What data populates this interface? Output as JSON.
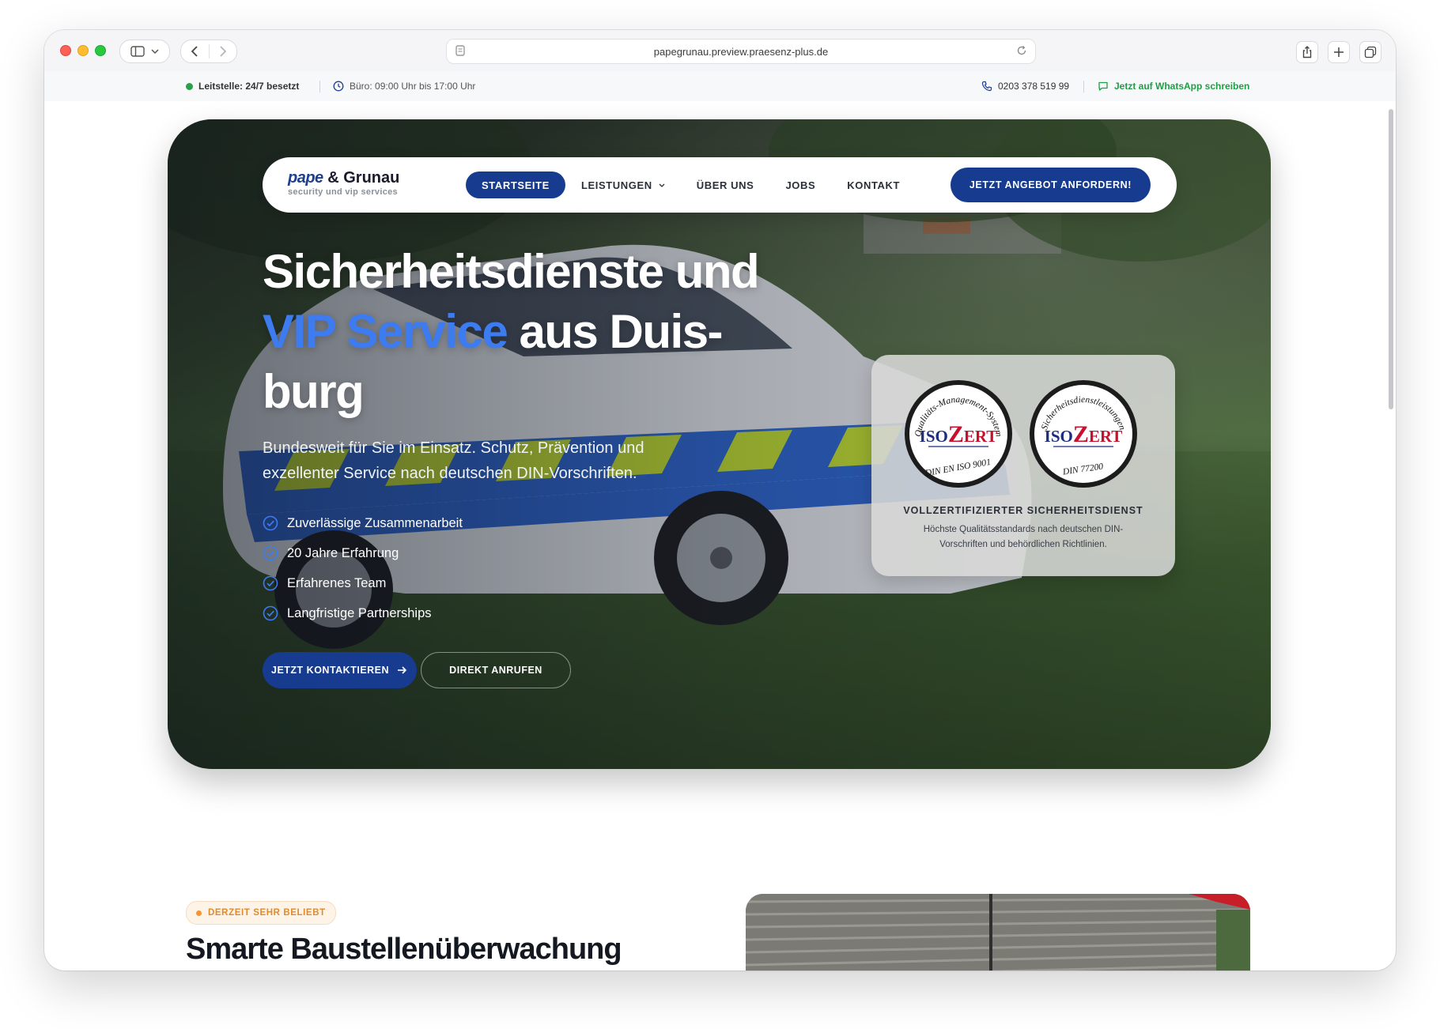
{
  "browser": {
    "url": "papegrunau.preview.praesenz-plus.de"
  },
  "topbar": {
    "status": "Leitstelle: 24/7 besetzt",
    "hours": "Büro: 09:00 Uhr bis 17:00 Uhr",
    "phone": "0203 378 519 99",
    "whatsapp": "Jetzt auf WhatsApp schreiben"
  },
  "logo": {
    "brand_part1": "pape",
    "brand_part2": "& Grunau",
    "tagline": "security und vip services"
  },
  "nav": {
    "items": [
      {
        "label": "STARTSEITE"
      },
      {
        "label": "LEISTUNGEN"
      },
      {
        "label": "ÜBER UNS"
      },
      {
        "label": "JOBS"
      },
      {
        "label": "KONTAKT"
      }
    ],
    "cta": "JETZT ANGEBOT ANFORDERN!"
  },
  "hero": {
    "headline_line1": "Sicherheitsdienste und",
    "headline_accent": "VIP Service",
    "headline_line2": " aus Duis-",
    "headline_line3": "burg",
    "subtitle": "Bundesweit für Sie im Einsatz. Schutz, Prävention und exzellenter Service nach deutschen DIN-Vorschriften.",
    "features": [
      "Zuverlässige Zusammenarbeit",
      "20 Jahre Erfahrung",
      "Erfahrenes Team",
      "Langfristige Partnerships"
    ],
    "btn_primary": "JETZT KONTAKTIEREN",
    "btn_secondary": "DIREKT ANRUFEN"
  },
  "certificates": {
    "seal1": {
      "arc": "Qualitäts-Management-System",
      "logo_iso": "ISO",
      "logo_z": "Z",
      "logo_ert": "ERT",
      "bottom": "DIN EN ISO 9001"
    },
    "seal2": {
      "arc": "Sicherheitsdienstleistungen",
      "logo_iso": "ISO",
      "logo_z": "Z",
      "logo_ert": "ERT",
      "bottom": "DIN 77200"
    },
    "title": "VOLLZERTIFIZIERTER SICHERHEITSDIENST",
    "text": "Höchste Qualitätsstandards nach deutschen DIN-Vorschriften und behördlichen Richtlinien."
  },
  "next_section": {
    "badge": "DERZEIT SEHR BELIEBT",
    "title": "Smarte Baustellenüberwachung"
  },
  "colors": {
    "primary": "#163b8f",
    "accent": "#3d7bf0",
    "whatsapp": "#1f9e45",
    "badge": "#e38a2c"
  }
}
